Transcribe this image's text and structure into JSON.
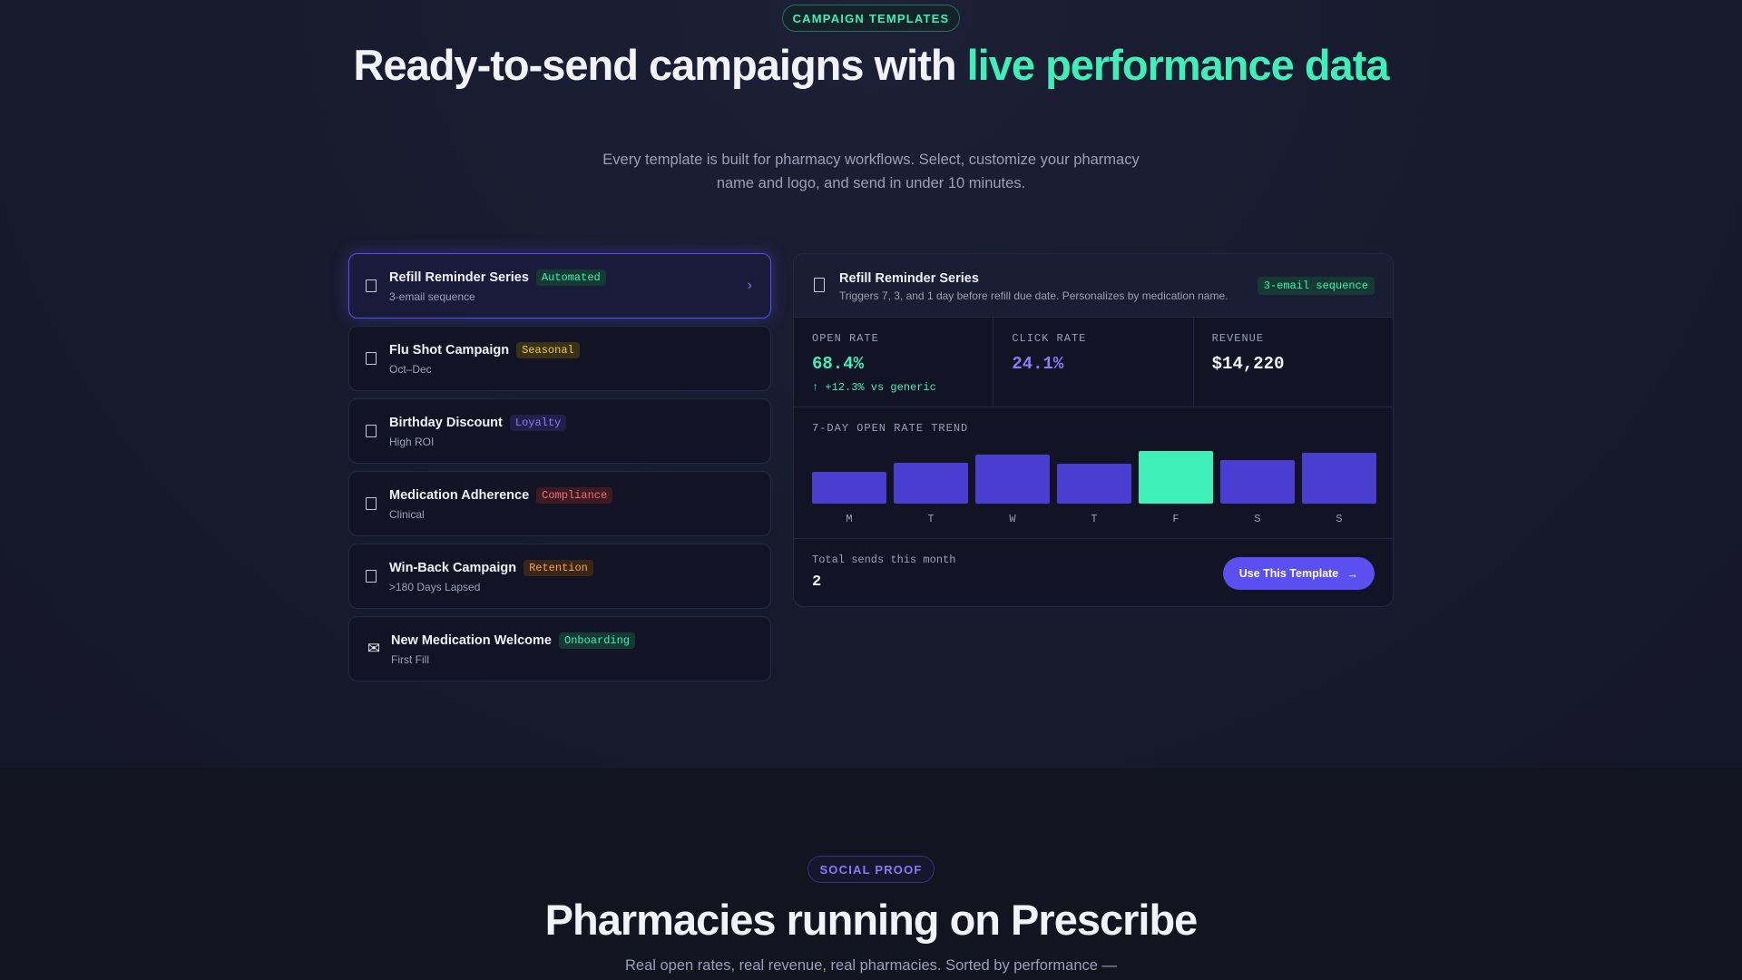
{
  "hero": {
    "pill": "CAMPAIGN TEMPLATES",
    "title_part1": "Ready-to-send campaigns with ",
    "title_accent": "live performance data",
    "subtitle": "Every template is built for pharmacy workflows. Select, customize your pharmacy name and logo, and send in under 10 minutes."
  },
  "templates": [
    {
      "title": "Refill Reminder Series",
      "badge": "Automated",
      "sub": "3-email sequence",
      "icon": "document-icon"
    },
    {
      "title": "Flu Shot Campaign",
      "badge": "Seasonal",
      "sub": "Oct–Dec",
      "icon": "document-icon"
    },
    {
      "title": "Birthday Discount",
      "badge": "Loyalty",
      "sub": "High ROI",
      "icon": "document-icon"
    },
    {
      "title": "Medication Adherence",
      "badge": "Compliance",
      "sub": "Clinical",
      "icon": "document-icon"
    },
    {
      "title": "Win-Back Campaign",
      "badge": "Retention",
      "sub": ">180 Days Lapsed",
      "icon": "document-icon"
    },
    {
      "title": "New Medication Welcome",
      "badge": "Onboarding",
      "sub": "First Fill",
      "icon": "mail-icon"
    }
  ],
  "colors": {
    "accent_green": "#3ef0b8",
    "accent_purple": "#5b4ff0",
    "bar_default": "#4a3ed0",
    "bar_highlight": "#3ef0b8"
  },
  "detail": {
    "title": "Refill Reminder Series",
    "subtitle": "Triggers 7, 3, and 1 day before refill due date. Personalizes by medication name.",
    "badge": "3-email sequence",
    "stats": {
      "open_rate_label": "OPEN RATE",
      "open_rate_value": "68.4%",
      "open_rate_delta": "↑ +12.3% vs generic",
      "click_rate_label": "CLICK RATE",
      "click_rate_value": "24.1%",
      "revenue_label": "REVENUE",
      "revenue_value": "$14,220"
    },
    "trend_label": "7-DAY OPEN RATE TREND",
    "footer_label": "Total sends this month",
    "footer_value": "2",
    "cta_label": "Use This Template",
    "cta_arrow": "→"
  },
  "chart_data": {
    "type": "bar",
    "categories": [
      "M",
      "T",
      "W",
      "T",
      "F",
      "S",
      "S"
    ],
    "values": [
      0.6,
      0.77,
      0.93,
      0.75,
      1.0,
      0.83,
      0.97
    ],
    "highlight_index": 4,
    "ylim": [
      0,
      1
    ]
  },
  "social": {
    "pill": "SOCIAL PROOF",
    "title": "Pharmacies running on Prescribe",
    "subtitle": "Real open rates, real revenue, real pharmacies. Sorted by performance —"
  }
}
